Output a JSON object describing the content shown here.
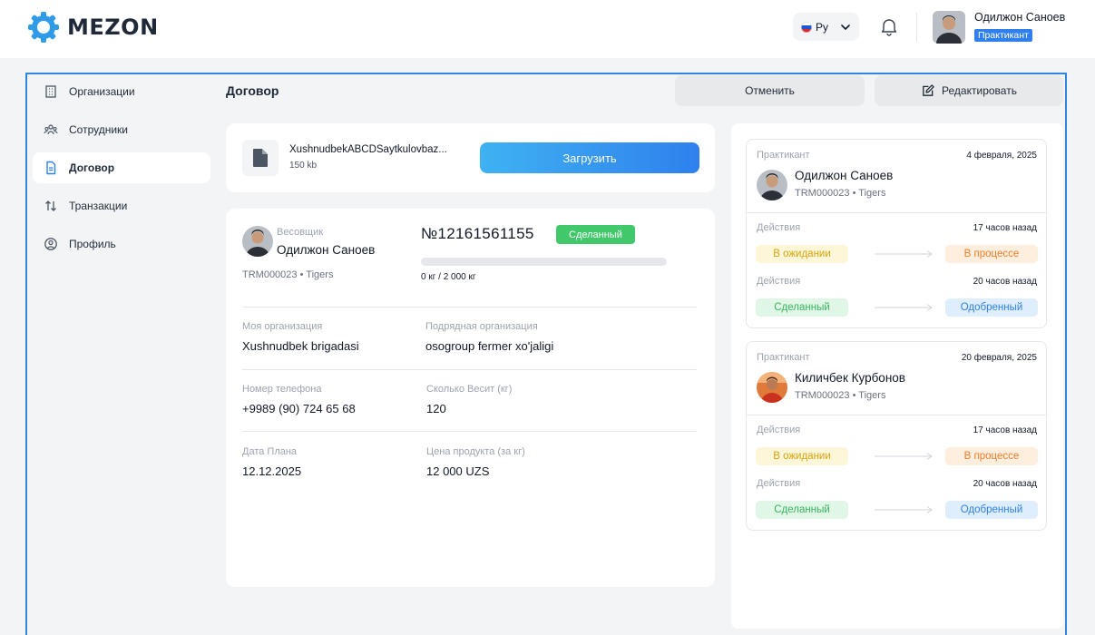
{
  "app": {
    "brand": "MEZON"
  },
  "header": {
    "language": "Ру",
    "user_name": "Одилжон Саноев",
    "user_role": "Практикант"
  },
  "sidebar": {
    "items": [
      {
        "label": "Организации",
        "icon": "building-icon",
        "active": false
      },
      {
        "label": "Сотрудники",
        "icon": "users-icon",
        "active": false
      },
      {
        "label": "Договор",
        "icon": "document-icon",
        "active": true
      },
      {
        "label": "Транзакции",
        "icon": "transfer-arrows-icon",
        "active": false
      },
      {
        "label": "Профиль",
        "icon": "profile-icon",
        "active": false
      }
    ]
  },
  "page": {
    "title": "Договор",
    "cancel_label": "Отменить",
    "edit_label": "Редактировать"
  },
  "upload": {
    "file_name": "XushnudbekABCDSaytkulovbaz...",
    "file_size": "150 kb",
    "upload_label": "Загрузить"
  },
  "contract": {
    "weigher_role": "Весовщик",
    "weigher_name": "Одилжон Саноев",
    "weigher_sub": "TRM000023 • Tigers",
    "number": "№12161561155",
    "status": "Сделанный",
    "progress_fraction": 0,
    "weight_text": "0 кг / 2 000 кг",
    "fields": {
      "my_org_label": "Моя организация",
      "my_org_value": "Xushnudbek brigadasi",
      "contractor_label": "Подрядная организация",
      "contractor_value": "osogroup fermer xo'jaligi",
      "phone_label": "Номер телефона",
      "phone_value": "+9989 (90) 724 65 68",
      "weight_label": "Сколько Весит (кг)",
      "weight_value": "120",
      "plan_date_label": "Дата Плана",
      "plan_date_value": "12.12.2025",
      "price_label": "Цена продукта (за кг)",
      "price_value": "12 000 UZS"
    }
  },
  "history": [
    {
      "role": "Практикант",
      "date": "4 февраля, 2025",
      "name": "Одилжон Саноев",
      "sub": "TRM000023 • Tigers",
      "actions": [
        {
          "label": "Действия",
          "time": "17 часов назад",
          "from": "В ожидании",
          "to": "В процессе"
        },
        {
          "label": "Действия",
          "time": "20 часов назад",
          "from": "Сделанный",
          "to": "Одобренный"
        }
      ]
    },
    {
      "role": "Практикант",
      "date": "20 февраля, 2025",
      "name": "Киличбек Курбонов",
      "sub": "TRM000023 • Tigers",
      "actions": [
        {
          "label": "Действия",
          "time": "17 часов назад",
          "from": "В ожидании",
          "to": "В процессе"
        },
        {
          "label": "Действия",
          "time": "20 часов назад",
          "from": "Сделанный",
          "to": "Одобренный"
        }
      ]
    }
  ]
}
